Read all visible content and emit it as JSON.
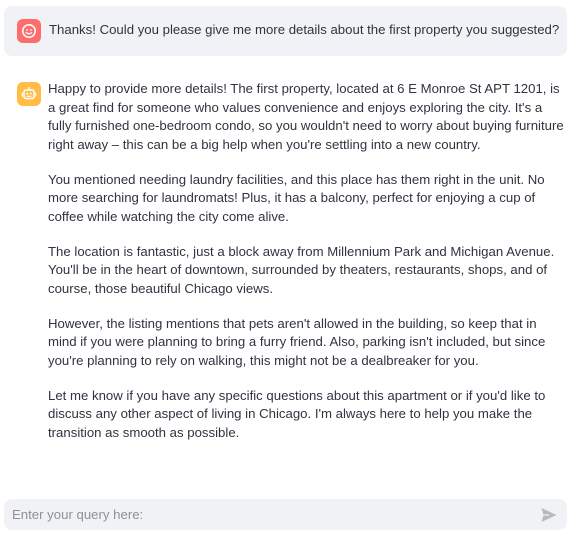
{
  "colors": {
    "user_avatar_bg": "#ff6c6c",
    "bot_avatar_bg": "#ffbd45",
    "message_bg": "#f0f2f6",
    "text": "#31333f"
  },
  "icons": {
    "user_avatar": "smiley-face-icon",
    "bot_avatar": "robot-icon",
    "send": "send-arrow-icon"
  },
  "chat": {
    "user_message": "Thanks! Could you please give me more details about the first property you suggested?",
    "assistant_paragraphs": [
      "Happy to provide more details! The first property, located at 6 E Monroe St APT 1201, is a great find for someone who values convenience and enjoys exploring the city. It's a fully furnished one-bedroom condo, so you wouldn't need to worry about buying furniture right away – this can be a big help when you're settling into a new country.",
      "You mentioned needing laundry facilities, and this place has them right in the unit. No more searching for laundromats! Plus, it has a balcony, perfect for enjoying a cup of coffee while watching the city come alive.",
      "The location is fantastic, just a block away from Millennium Park and Michigan Avenue. You'll be in the heart of downtown, surrounded by theaters, restaurants, shops, and of course, those beautiful Chicago views.",
      "However, the listing mentions that pets aren't allowed in the building, so keep that in mind if you were planning to bring a furry friend. Also, parking isn't included, but since you're planning to rely on walking, this might not be a dealbreaker for you.",
      "Let me know if you have any specific questions about this apartment or if you'd like to discuss any other aspect of living in Chicago. I'm always here to help you make the transition as smooth as possible."
    ]
  },
  "input": {
    "placeholder": "Enter your query here:",
    "value": ""
  }
}
